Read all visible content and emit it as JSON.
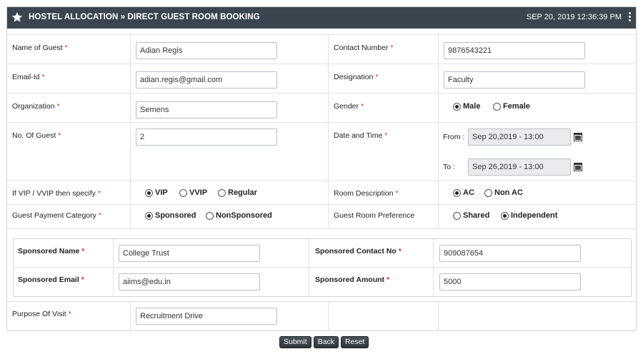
{
  "header": {
    "title": "HOSTEL ALLOCATION » DIRECT GUEST ROOM BOOKING",
    "datetime": "SEP 20, 2019  12:36:39 PM"
  },
  "form": {
    "required_mark": "*",
    "name_of_guest": {
      "label": "Name of Guest",
      "value": "Adian Regis"
    },
    "contact_number": {
      "label": "Contact Number",
      "value": "9876543221"
    },
    "email": {
      "label": "Email-Id",
      "value": "adian.regis@gmail.com"
    },
    "designation": {
      "label": "Designation",
      "value": "Faculty"
    },
    "organization": {
      "label": "Organization",
      "value": "Semens"
    },
    "gender": {
      "label": "Gender",
      "options": [
        "Male",
        "Female"
      ],
      "selected": "Male"
    },
    "no_of_guest": {
      "label": "No. Of Guest",
      "value": "2"
    },
    "date_time": {
      "label": "Date and Time",
      "from_label": "From :",
      "from_value": "Sep 20,2019 - 13:00",
      "to_label": "To :",
      "to_value": "Sep 26,2019 - 13:00"
    },
    "vip": {
      "label": "If VIP / VVIP then specify",
      "options": [
        "VIP",
        "VVIP",
        "Regular"
      ],
      "selected": "VIP"
    },
    "room_description": {
      "label": "Room Description",
      "options": [
        "AC",
        "Non AC"
      ],
      "selected": "AC"
    },
    "payment_category": {
      "label": "Guest Payment Category",
      "options": [
        "Sponsored",
        "NonSponsored"
      ],
      "selected": "Sponsored"
    },
    "room_preference": {
      "label": "Guest Room Preference",
      "options": [
        "Shared",
        "Independent"
      ],
      "selected": "Independent"
    },
    "sponsored_name": {
      "label": "Sponsored Name",
      "value": "College Trust"
    },
    "sponsored_contact": {
      "label": "Sponsored Contact No",
      "value": "909087654"
    },
    "sponsored_email": {
      "label": "Sponsored Email",
      "value": "aiims@edu.in"
    },
    "sponsored_amount": {
      "label": "Sponsored Amount",
      "value": "5000"
    },
    "purpose": {
      "label": "Purpose Of Visit",
      "value": "Recruitment Drive"
    }
  },
  "buttons": {
    "submit": "Submit",
    "back": "Back",
    "reset": "Reset"
  }
}
